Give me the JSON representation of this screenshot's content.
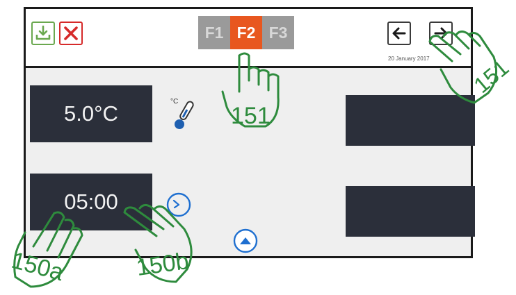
{
  "header": {
    "tabs": [
      "F1",
      "F2",
      "F3"
    ],
    "active_tab": "F2",
    "date": "20 January 2017"
  },
  "controls": {
    "temperature": "5.0°C",
    "time": "05:00",
    "thermometer_unit": "°C"
  },
  "annotations": {
    "tab_callout": "151",
    "nav_callout": "151",
    "temp_callout": "150a",
    "time_callout": "150b"
  },
  "colors": {
    "active_tab": "#e8571f",
    "inactive_tab": "#9a9a9a",
    "panel": "#2b2f3a",
    "accent_blue": "#1e6fd0",
    "download_green": "#6aa84f",
    "cancel_red": "#d62a2a",
    "annotation_green": "#2e8b3d"
  },
  "icons": [
    "download-icon",
    "close-icon",
    "arrow-left-icon",
    "arrow-right-icon",
    "thermometer-icon",
    "clock-icon",
    "chevron-up-icon",
    "pointing-hand-icon"
  ]
}
